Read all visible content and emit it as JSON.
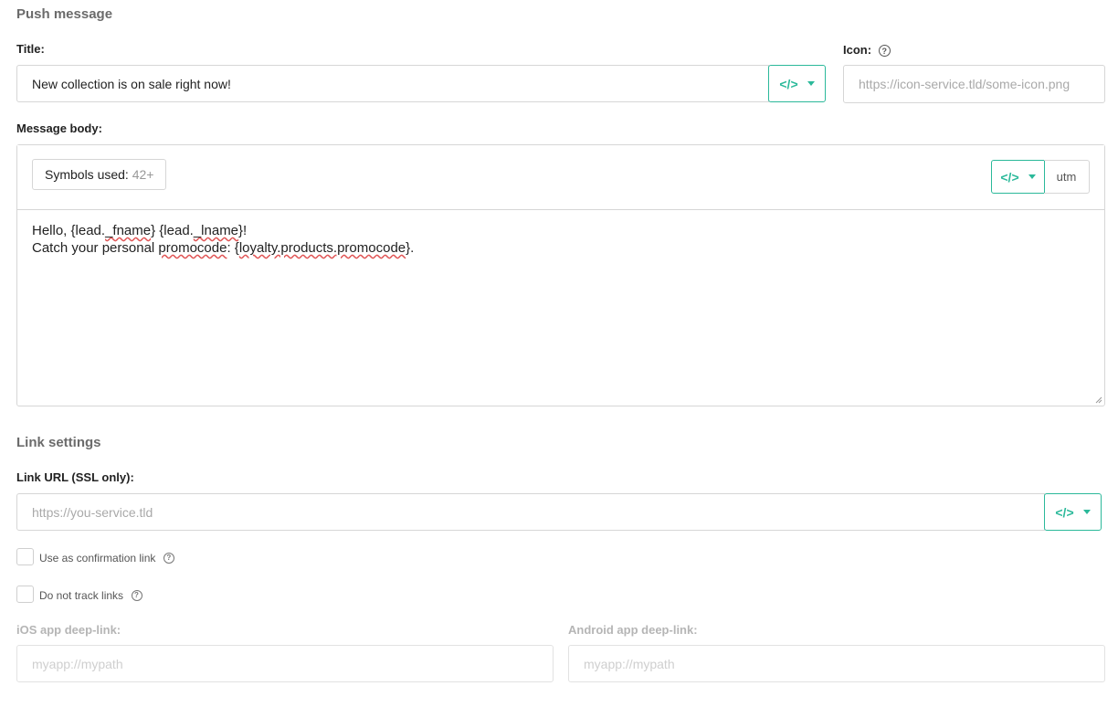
{
  "push": {
    "section_title": "Push message",
    "title_label": "Title:",
    "title_value": "New collection is on sale right now!",
    "icon_label": "Icon:",
    "icon_placeholder": "https://icon-service.tld/some-icon.png",
    "message_label": "Message body:",
    "symbols_label": "Symbols used:",
    "symbols_count": "42+",
    "utm_label": "utm",
    "body_line1": [
      "Hello, {lead.",
      "_fname",
      "} {lead.",
      "_lname",
      "}!"
    ],
    "body_line2": [
      "Catch your personal ",
      "promocode",
      ": {",
      "loyalty.products.promocode",
      "}."
    ]
  },
  "link": {
    "section_title": "Link settings",
    "url_label": "Link URL (SSL only):",
    "url_placeholder": "https://you-service.tld",
    "confirm_label": "Use as confirmation link",
    "notrack_label": "Do not track links",
    "ios_label": "iOS app deep-link:",
    "ios_placeholder": "myapp://mypath",
    "android_label": "Android app deep-link:",
    "android_placeholder": "myapp://mypath"
  },
  "icons": {
    "code": "</>",
    "help": "?"
  },
  "colors": {
    "accent": "#2bb99a",
    "border": "#d6d6d6",
    "squiggle": "#e05555"
  }
}
